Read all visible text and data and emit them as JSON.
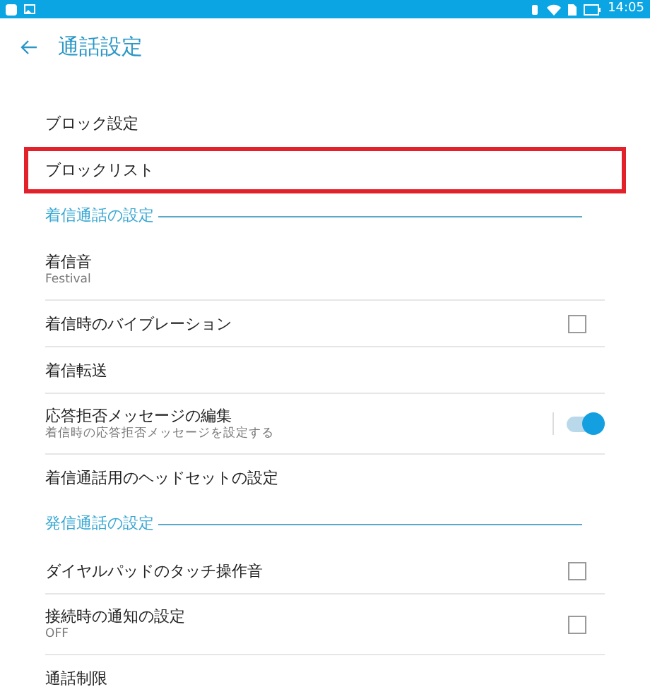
{
  "status_bar": {
    "time": "14:05"
  },
  "header": {
    "title": "通話設定"
  },
  "sections": [
    {
      "items": [
        {
          "kind": "plain",
          "label": "ブロック設定",
          "highlighted": false
        },
        {
          "kind": "plain",
          "label": "ブロックリスト",
          "highlighted": true
        }
      ]
    },
    {
      "title": "着信通話の設定",
      "items": [
        {
          "kind": "plain",
          "label": "着信音",
          "summary": "Festival",
          "highlighted": false
        },
        {
          "kind": "checkbox",
          "label": "着信時のバイブレーション",
          "checked": false,
          "highlighted": false
        },
        {
          "kind": "plain",
          "label": "着信転送",
          "highlighted": false
        },
        {
          "kind": "switch",
          "label": "応答拒否メッセージの編集",
          "summary": "着信時の応答拒否メッセージを設定する",
          "on": true,
          "highlighted": false
        },
        {
          "kind": "plain",
          "label": "着信通話用のヘッドセットの設定",
          "highlighted": false
        }
      ]
    },
    {
      "title": "発信通話の設定",
      "items": [
        {
          "kind": "checkbox",
          "label": "ダイヤルパッドのタッチ操作音",
          "checked": false,
          "highlighted": false
        },
        {
          "kind": "checkbox",
          "label": "接続時の通知の設定",
          "summary": "OFF",
          "checked": false,
          "highlighted": false
        },
        {
          "kind": "plain",
          "label": "通話制限",
          "highlighted": false
        }
      ]
    }
  ]
}
